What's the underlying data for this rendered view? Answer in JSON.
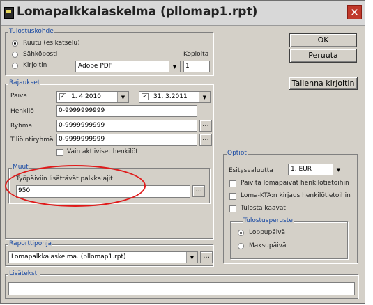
{
  "window": {
    "title": "Lomapalkkalaskelma (pllomap1.rpt)",
    "close_label": "✕"
  },
  "buttons": {
    "ok": "OK",
    "cancel": "Peruuta",
    "save_printer": "Tallenna kirjoitin",
    "browse": "..."
  },
  "output": {
    "group_label": "Tulostuskohde",
    "options": [
      "Ruutu (esikatselu)",
      "Sähköposti",
      "Kirjoitin"
    ],
    "selected": "Ruutu (esikatselu)",
    "printer": "Adobe PDF",
    "copies_label": "Kopioita",
    "copies": "1"
  },
  "limits": {
    "group_label": "Rajaukset",
    "date_label": "Päivä",
    "date_from": "1. 4.2010",
    "date_to": "31. 3.2011",
    "person_label": "Henkilö",
    "person": "0-9999999999",
    "group_field_label": "Ryhmä",
    "group_value": "0-9999999999",
    "account_label": "Tiliöintiryhmä",
    "account_value": "0-9999999999",
    "active_only_label": "Vain aktiiviset henkilöt",
    "active_only": false
  },
  "other": {
    "group_label": "Muut",
    "workdays_label": "Työpäiviin lisättävät palkkalajit",
    "workdays_value": "950"
  },
  "options": {
    "group_label": "Optiot",
    "currency_label": "Esitysvaluutta",
    "currency": "1. EUR",
    "checks": [
      {
        "label": "Päivitä lomapäivät henkilötietoihin",
        "checked": false
      },
      {
        "label": "Loma-KTA:n kirjaus henkilötietoihin",
        "checked": false
      },
      {
        "label": "Tulosta kaavat",
        "checked": false
      }
    ]
  },
  "print_basis": {
    "group_label": "Tulostusperuste",
    "options": [
      "Loppupäivä",
      "Maksupäivä"
    ],
    "selected": "Loppupäivä"
  },
  "report_template": {
    "group_label": "Raporttipohja",
    "value": "Lomapalkkalaskelma. (pllomap1.rpt)"
  },
  "extra_text": {
    "group_label": "Lisäteksti",
    "value": ""
  },
  "colors": {
    "group_label": "#1a4aa3",
    "highlight_oval": "#e01a1a",
    "dialog_bg": "#d4d0c8"
  }
}
